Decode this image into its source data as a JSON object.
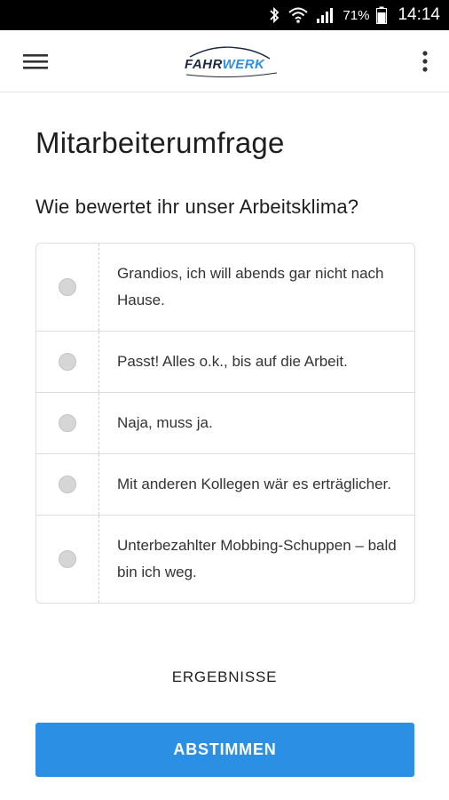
{
  "status_bar": {
    "battery_percent": "71%",
    "time": "14:14",
    "icons": [
      "bluetooth-icon",
      "wifi-icon",
      "signal-icon",
      "battery-icon"
    ]
  },
  "app_bar": {
    "logo_part1": "FAHR",
    "logo_part2": "WERK",
    "menu_icon": "hamburger-menu-icon",
    "more_icon": "more-vertical-icon"
  },
  "page": {
    "title": "Mitarbeiterumfrage",
    "question": "Wie bewertet ihr unser Arbeitsklima?",
    "options": [
      {
        "label": "Grandios, ich will abends gar nicht nach Hause.",
        "selected": false
      },
      {
        "label": "Passt! Alles o.k., bis auf die Arbeit.",
        "selected": false
      },
      {
        "label": "Naja, muss ja.",
        "selected": false
      },
      {
        "label": "Mit anderen Kollegen wär es erträglicher.",
        "selected": false
      },
      {
        "label": "Unterbezahlter Mobbing-Schuppen – bald bin ich weg.",
        "selected": false
      }
    ],
    "results_label": "ERGEBNISSE",
    "vote_label": "ABSTIMMEN"
  },
  "colors": {
    "accent": "#2b90e4",
    "logo_dark": "#1e2a44",
    "logo_blue": "#2e8fe6"
  }
}
